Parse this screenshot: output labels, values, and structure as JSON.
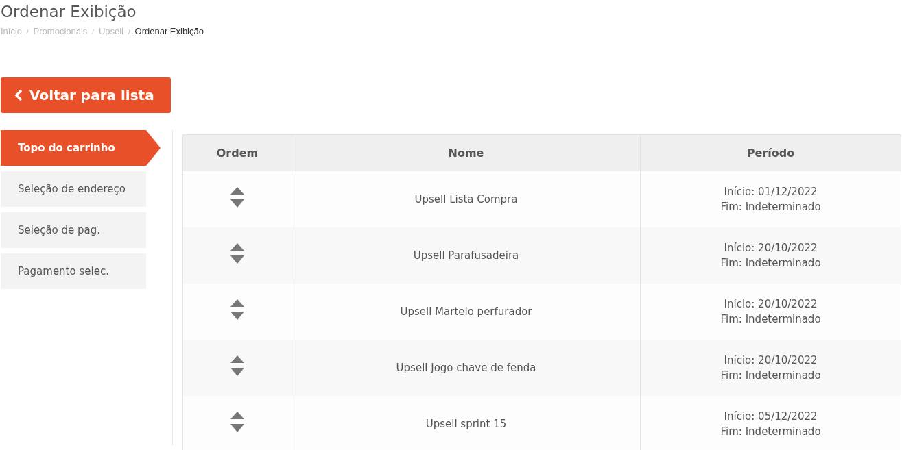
{
  "page_title": "Ordenar Exibição",
  "breadcrumb": [
    {
      "kind": "link",
      "label": "Início"
    },
    {
      "kind": "separator",
      "label": "/"
    },
    {
      "kind": "link",
      "label": "Promocionais"
    },
    {
      "kind": "separator",
      "label": "/"
    },
    {
      "kind": "link",
      "label": "Upsell"
    },
    {
      "kind": "separator",
      "label": "/"
    },
    {
      "kind": "current",
      "label": "Ordenar Exibição"
    }
  ],
  "back_button": {
    "label": "Voltar para lista"
  },
  "sidebar": {
    "items": [
      {
        "label": "Topo do carrinho",
        "selected": true
      },
      {
        "label": "Seleção de endereço",
        "selected": false
      },
      {
        "label": "Seleção de pag.",
        "selected": false
      },
      {
        "label": "Pagamento selec.",
        "selected": false
      }
    ]
  },
  "table": {
    "columns": [
      "Ordem",
      "Nome",
      "Período"
    ],
    "rows": [
      {
        "name": "Upsell Lista Compra",
        "start": "Início: 01/12/2022",
        "end": "Fim: Indeterminado"
      },
      {
        "name": "Upsell Parafusadeira",
        "start": "Início: 20/10/2022",
        "end": "Fim: Indeterminado"
      },
      {
        "name": "Upsell Martelo perfurador",
        "start": "Início: 20/10/2022",
        "end": "Fim: Indeterminado"
      },
      {
        "name": "Upsell Jogo chave de fenda",
        "start": "Início: 20/10/2022",
        "end": "Fim: Indeterminado"
      },
      {
        "name": "Upsell sprint 15",
        "start": "Início: 05/12/2022",
        "end": "Fim: Indeterminado"
      }
    ]
  }
}
